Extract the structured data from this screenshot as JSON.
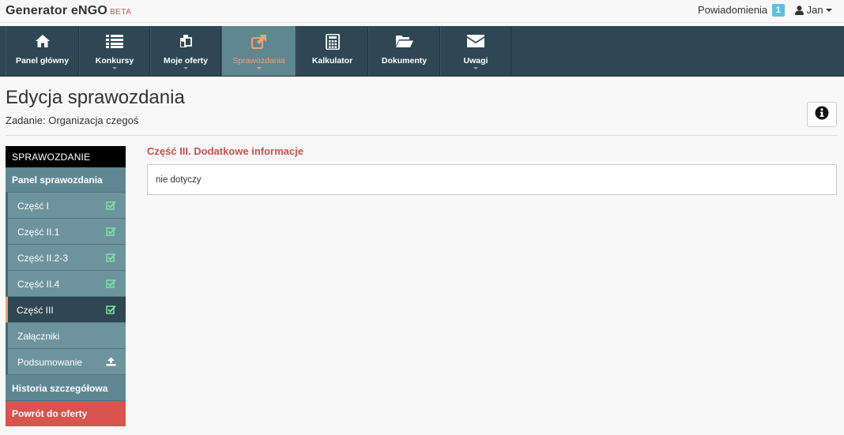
{
  "brand": {
    "name": "Generator eNGO",
    "beta": "BETA"
  },
  "topbar": {
    "notifications_label": "Powiadomienia",
    "notifications_count": "1",
    "user_name": "Jan"
  },
  "nav": {
    "items": [
      {
        "label": "Panel główny",
        "icon": "home-icon"
      },
      {
        "label": "Konkursy",
        "icon": "list-icon"
      },
      {
        "label": "Moje oferty",
        "icon": "copy-icon"
      },
      {
        "label": "Sprawozdania",
        "icon": "external-link-icon",
        "active": true
      },
      {
        "label": "Kalkulator",
        "icon": "calculator-icon"
      },
      {
        "label": "Dokumenty",
        "icon": "folder-open-icon"
      },
      {
        "label": "Uwagi",
        "icon": "envelope-icon"
      }
    ]
  },
  "page": {
    "title": "Edycja sprawozdania",
    "subtitle": "Zadanie: Organizacja czegoś"
  },
  "sidebar": {
    "header": "SPRAWOZDANIE",
    "panel": "Panel sprawozdania",
    "items": [
      {
        "label": "Część I",
        "icon": "check-square-icon"
      },
      {
        "label": "Część II.1",
        "icon": "check-square-icon"
      },
      {
        "label": "Część II.2-3",
        "icon": "check-square-icon"
      },
      {
        "label": "Część II.4",
        "icon": "check-square-icon"
      },
      {
        "label": "Część III",
        "icon": "check-square-icon",
        "active": true
      },
      {
        "label": "Załączniki",
        "icon": ""
      },
      {
        "label": "Podsumowanie",
        "icon": "upload-icon"
      }
    ],
    "history": "Historia szczegółowa",
    "back": "Powrót do oferty"
  },
  "content": {
    "section_title": "Część III. Dodatkowe informacje",
    "answer": "nie dotyczy"
  },
  "colors": {
    "nav_bg": "#2e4753",
    "nav_active": "#5f8792",
    "accent_orange": "#f0a070",
    "danger": "#d9534f",
    "check_green": "#7ee0a0"
  }
}
